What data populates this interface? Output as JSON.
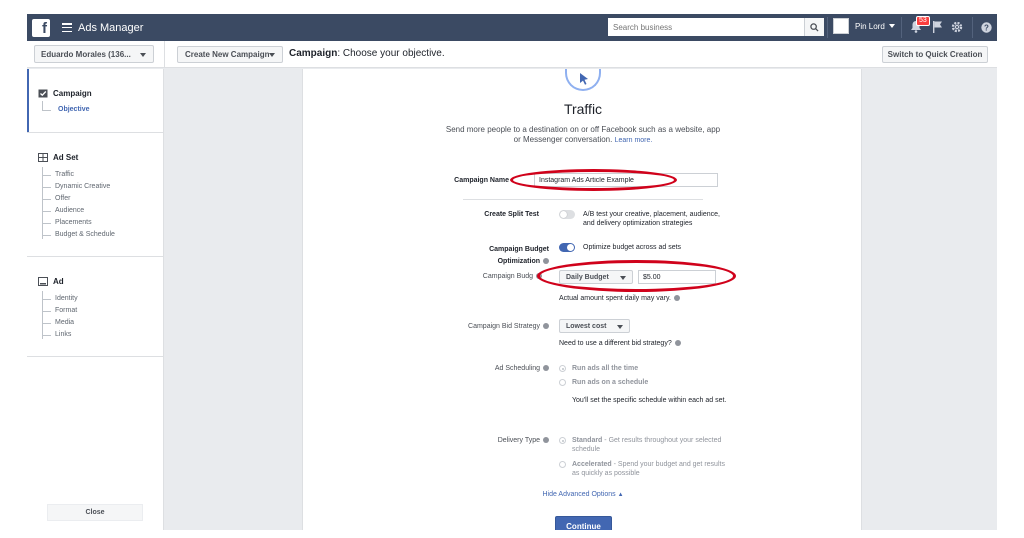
{
  "topbar": {
    "app_title": "Ads Manager",
    "logo": "f",
    "search_placeholder": "Search business",
    "user_name": "Pin Lord",
    "notification_count": "53"
  },
  "subbar": {
    "account": "Eduardo Morales (136...",
    "create_label": "Create New Campaign",
    "header_bold": "Campaign",
    "header_rest": ": Choose your objective.",
    "quick_label": "Switch to Quick Creation"
  },
  "sidebar": {
    "campaign": {
      "title": "Campaign",
      "items": [
        "Objective"
      ]
    },
    "adset": {
      "title": "Ad Set",
      "items": [
        "Traffic",
        "Dynamic Creative",
        "Offer",
        "Audience",
        "Placements",
        "Budget & Schedule"
      ]
    },
    "ad": {
      "title": "Ad",
      "items": [
        "Identity",
        "Format",
        "Media",
        "Links"
      ]
    },
    "close_label": "Close"
  },
  "main": {
    "title": "Traffic",
    "description": "Send more people to a destination on or off Facebook such as a website, app or Messenger conversation.",
    "learn_more": "Learn more.",
    "campaign_name_label": "Campaign Name",
    "campaign_name_value": "Instagram Ads Article Example",
    "split_label": "Create Split Test",
    "split_text": "A/B test your creative, placement, audience, and delivery optimization strategies",
    "cbo_label_1": "Campaign Budget",
    "cbo_label_2": "Optimization",
    "cbo_text": "Optimize budget across ad sets",
    "budget_label": "Campaign Budg",
    "budget_type": "Daily Budget",
    "budget_value": "$5.00",
    "budget_note": "Actual amount spent daily may vary.",
    "bid_label": "Campaign Bid Strategy",
    "bid_value": "Lowest cost",
    "bid_note": "Need to use a different bid strategy?",
    "sched_label": "Ad Scheduling",
    "sched_opt1": "Run ads all the time",
    "sched_opt2": "Run ads on a schedule",
    "sched_note": "You'll set the specific schedule within each ad set.",
    "delivery_label": "Delivery Type",
    "delivery_opt1_bold": "Standard",
    "delivery_opt1_rest": " - Get results throughout your selected schedule",
    "delivery_opt2_bold": "Accelerated",
    "delivery_opt2_rest": " - Spend your budget and get results as quickly as possible",
    "hide_advanced": "Hide Advanced Options",
    "continue_label": "Continue"
  },
  "colors": {
    "topbar": "#3b4a63",
    "accent": "#4267b2",
    "annotation": "#d0021b"
  }
}
